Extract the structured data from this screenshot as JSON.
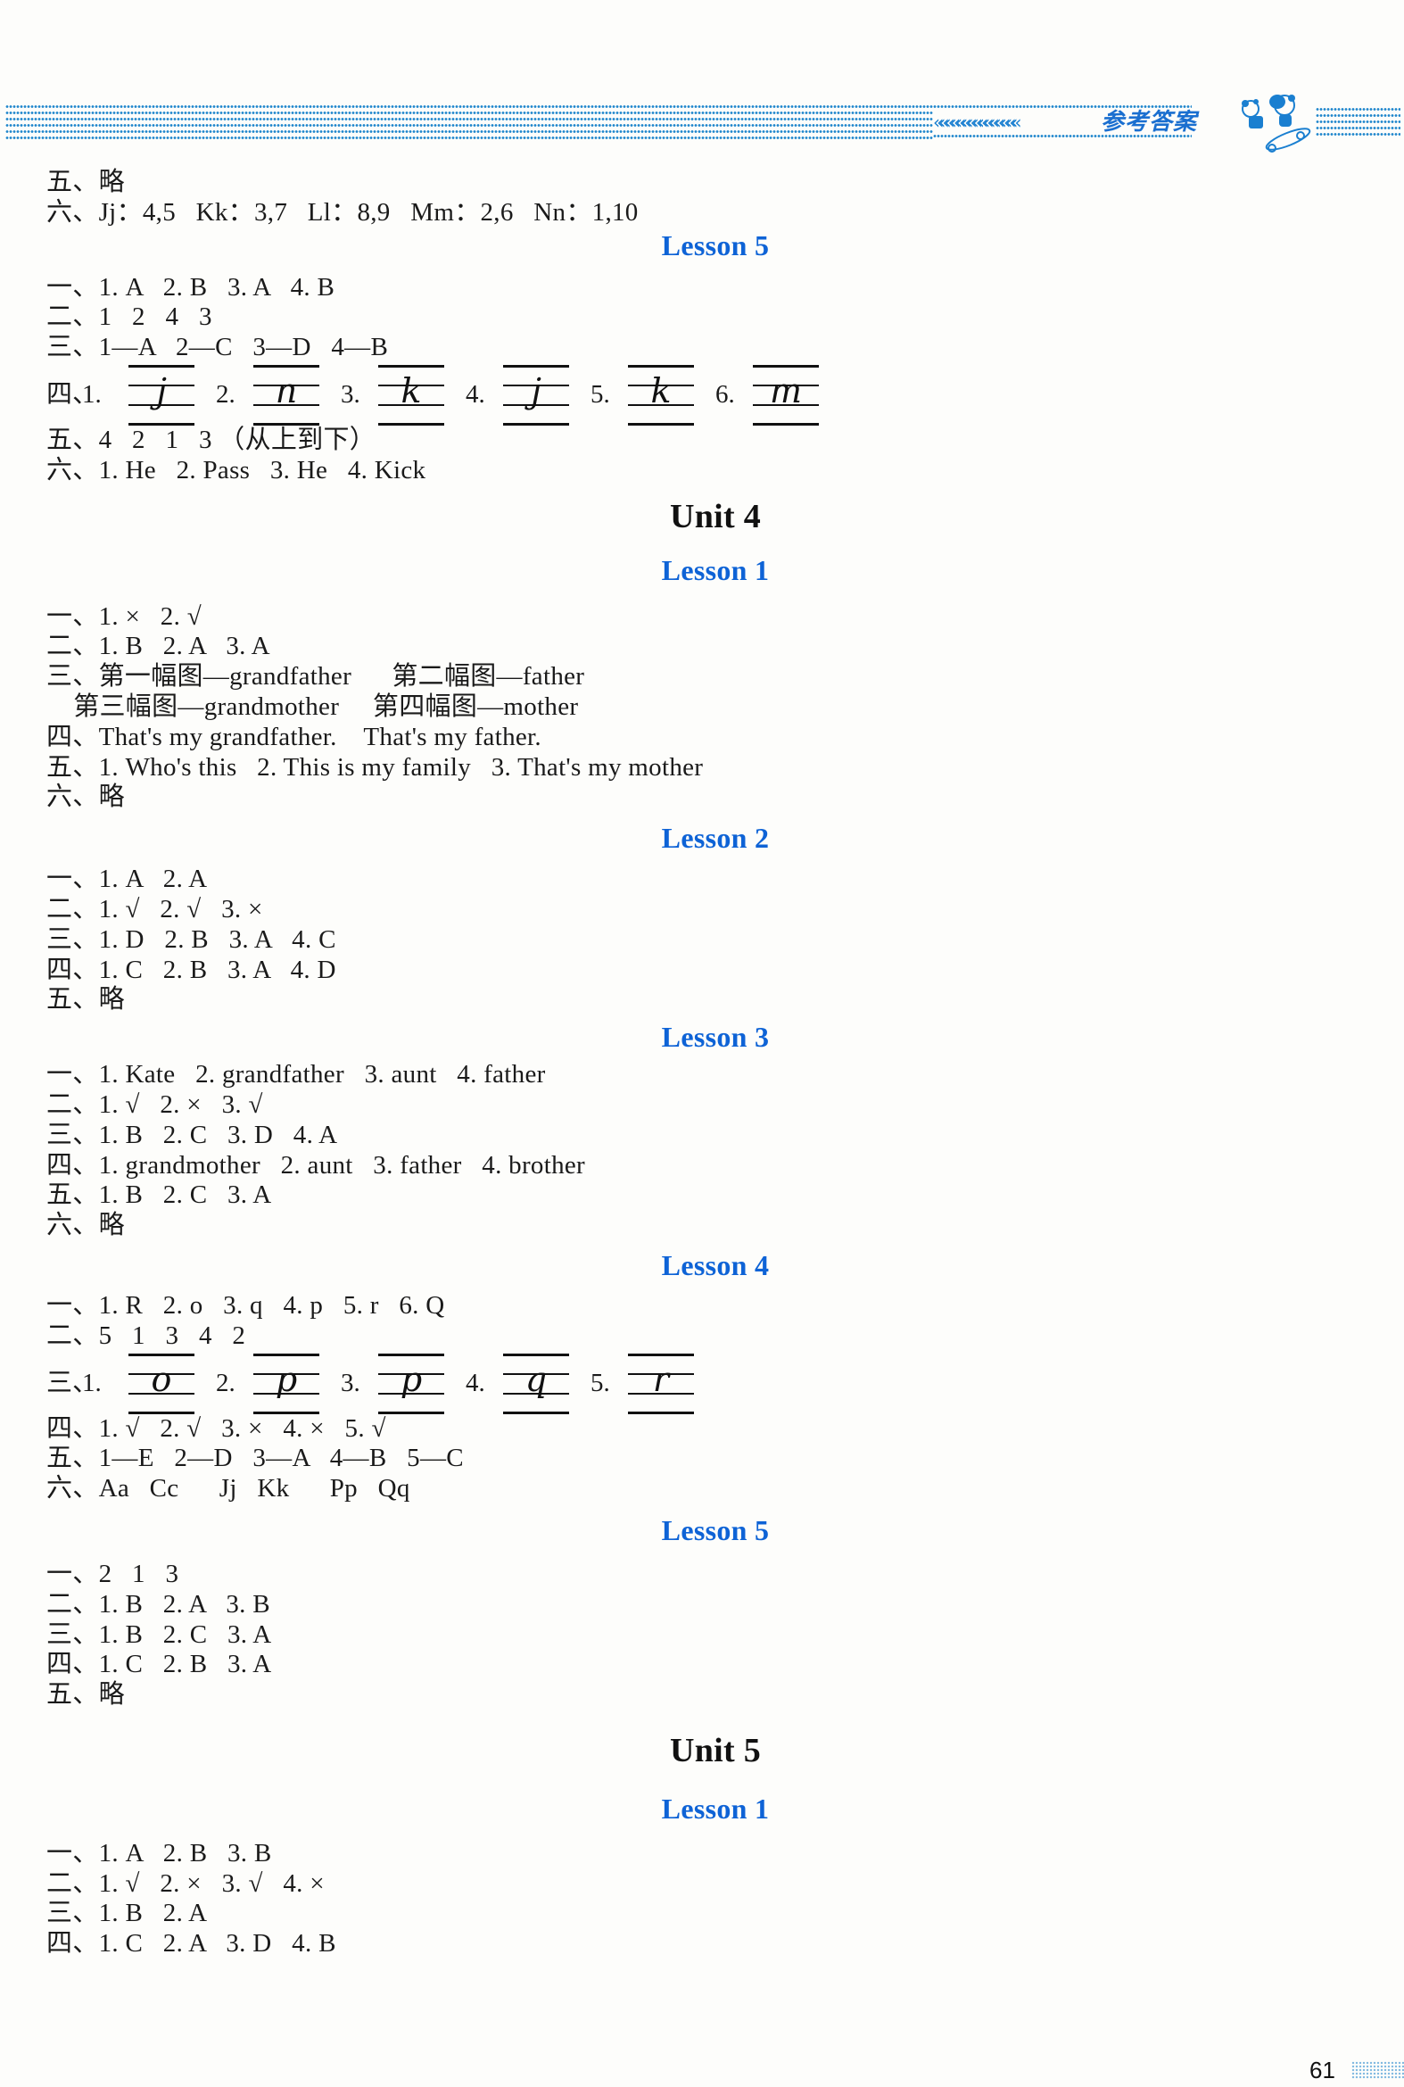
{
  "header": {
    "title": "参考答案",
    "chevrons": "«««««««««««««««",
    "mascot_icon": "panda-skateboard-icon",
    "accent_color": "#1a7fd0"
  },
  "page_number": "61",
  "lesson_color": "#0e63d6",
  "top_lines": [
    "五、略",
    "六、Jj：4,5   Kk：3,7   Ll：8,9   Mm：2,6   Nn：1,10"
  ],
  "unit3_lesson5": {
    "title": "Lesson 5",
    "lines": [
      "一、1. A   2. B   3. A   4. B",
      "二、1   2   4   3",
      "三、1—A   2—C   3—D   4—B"
    ],
    "writing": {
      "prefix": "四、",
      "items": [
        {
          "num": "1.",
          "letter": "j"
        },
        {
          "num": "2.",
          "letter": "n"
        },
        {
          "num": "3.",
          "letter": "k"
        },
        {
          "num": "4.",
          "letter": "j"
        },
        {
          "num": "5.",
          "letter": "k"
        },
        {
          "num": "6.",
          "letter": "m"
        }
      ]
    },
    "lines_after": [
      "五、4   2   1   3 （从上到下）",
      "六、1. He   2. Pass   3. He   4. Kick"
    ]
  },
  "unit4": {
    "title": "Unit 4",
    "lessons": [
      {
        "title": "Lesson 1",
        "lines": [
          "一、1. ×   2. √",
          "二、1. B   2. A   3. A",
          "三、第一幅图—grandfather      第二幅图—father",
          "    第三幅图—grandmother     第四幅图—mother",
          "四、That's my grandfather.    That's my father.",
          "五、1. Who's this   2. This is my family   3. That's my mother",
          "六、略"
        ]
      },
      {
        "title": "Lesson 2",
        "lines": [
          "一、1. A   2. A",
          "二、1. √   2. √   3. ×",
          "三、1. D   2. B   3. A   4. C",
          "四、1. C   2. B   3. A   4. D",
          "五、略"
        ]
      },
      {
        "title": "Lesson 3",
        "lines": [
          "一、1. Kate   2. grandfather   3. aunt   4. father",
          "二、1. √   2. ×   3. √",
          "三、1. B   2. C   3. D   4. A",
          "四、1. grandmother   2. aunt   3. father   4. brother",
          "五、1. B   2. C   3. A",
          "六、略"
        ]
      },
      {
        "title": "Lesson 4",
        "lines_before": [
          "一、1. R   2. o   3. q   4. p   5. r   6. Q",
          "二、5   1   3   4   2"
        ],
        "writing": {
          "prefix": "三、",
          "items": [
            {
              "num": "1.",
              "letter": "o"
            },
            {
              "num": "2.",
              "letter": "p"
            },
            {
              "num": "3.",
              "letter": "p"
            },
            {
              "num": "4.",
              "letter": "q"
            },
            {
              "num": "5.",
              "letter": "r"
            }
          ]
        },
        "lines_after": [
          "四、1. √   2. √   3. ×   4. ×   5. √",
          "五、1—E   2—D   3—A   4—B   5—C",
          "六、Aa   Cc      Jj   Kk      Pp   Qq"
        ]
      },
      {
        "title": "Lesson 5",
        "lines": [
          "一、2   1   3",
          "二、1. B   2. A   3. B",
          "三、1. B   2. C   3. A",
          "四、1. C   2. B   3. A",
          "五、略"
        ]
      }
    ]
  },
  "unit5": {
    "title": "Unit 5",
    "lessons": [
      {
        "title": "Lesson 1",
        "lines": [
          "一、1. A   2. B   3. B",
          "二、1. √   2. ×   3. √   4. ×",
          "三、1. B   2. A",
          "四、1. C   2. A   3. D   4. B"
        ]
      }
    ]
  }
}
